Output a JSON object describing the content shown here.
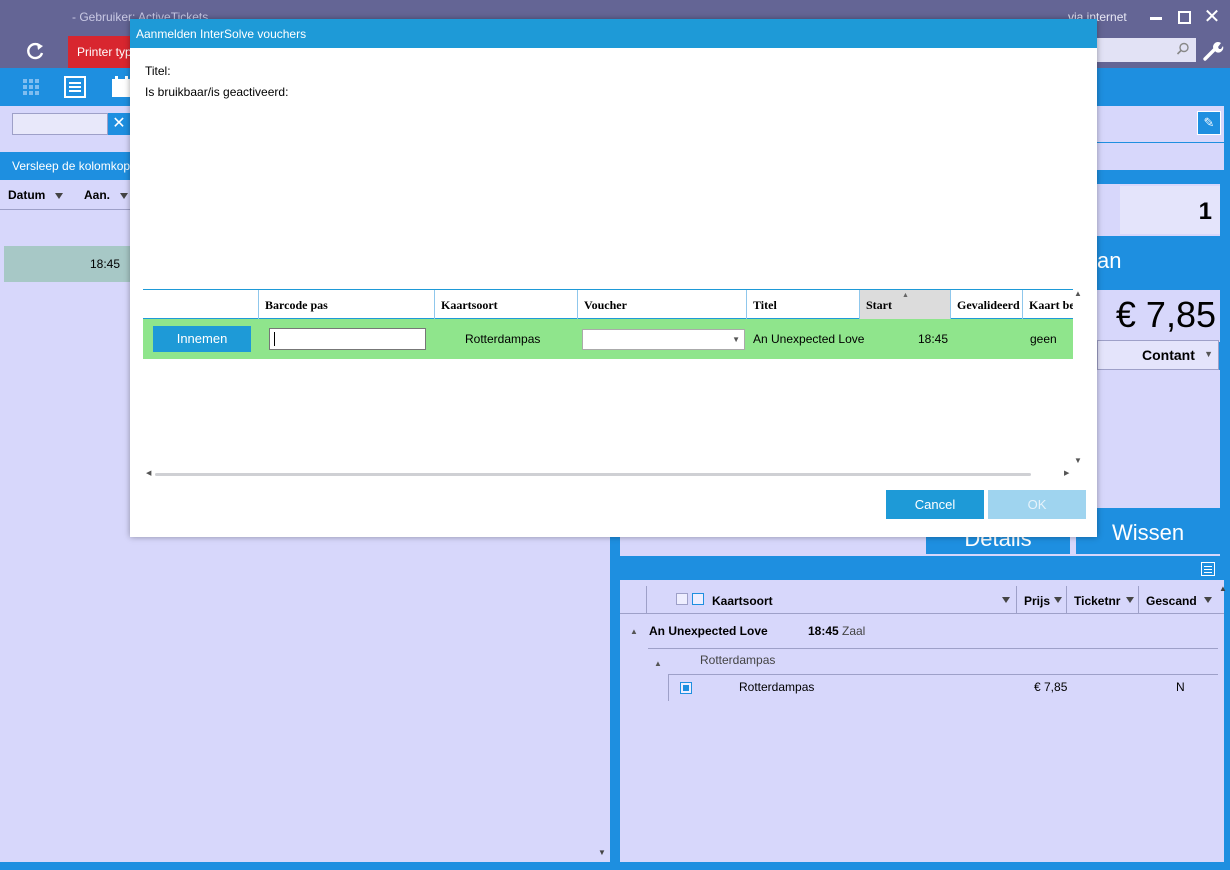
{
  "window": {
    "title": "- Gebruiker: ActiveTickets",
    "connection": "via internet"
  },
  "toolbar": {
    "printer_label": "Printer type"
  },
  "left": {
    "group_hint": "Versleep de kolomkoptekst hierheen om op die kolom te groeperen",
    "columns": [
      "Datum",
      "Aan."
    ],
    "row_time": "18:45"
  },
  "right": {
    "quantity": "1",
    "action_label": "an",
    "total_price": "€ 7,85",
    "payment_method": "Contant",
    "details_label": "Details",
    "wissen_label": "Wissen",
    "tickets": {
      "columns": [
        "Kaartsoort",
        "Prijs",
        "Ticketnr",
        "Gescand"
      ],
      "group": {
        "title": "An Unexpected Love",
        "time": "18:45",
        "hall": "Zaal"
      },
      "subgroup": "Rotterdampas",
      "row": {
        "kaartsoort": "Rotterdampas",
        "prijs": "€ 7,85",
        "gescand": "N"
      }
    }
  },
  "modal": {
    "title": "Aanmelden InterSolve vouchers",
    "label_titel": "Titel:",
    "label_bruikbaar": "Is bruikbaar/is geactiveerd:",
    "columns": {
      "barcode": "Barcode pas",
      "kaartsoort": "Kaartsoort",
      "voucher": "Voucher",
      "titel": "Titel",
      "start": "Start",
      "gevalideerd": "Gevalideerd",
      "kaart_be": "Kaart be"
    },
    "row": {
      "innemen_label": "Innemen",
      "barcode_value": "",
      "kaartsoort": "Rotterdampas",
      "voucher_value": "",
      "titel": "An Unexpected Love",
      "start": "18:45",
      "kaart_be": "geen"
    },
    "cancel_label": "Cancel",
    "ok_label": "OK"
  },
  "colors": {
    "accent_blue": "#1e8fe0",
    "dialog_blue": "#1e9ad7",
    "titlebar": "#646595",
    "panel_bg": "#d7d7fb",
    "printer_red": "#d8262f",
    "row_green": "#8fe58c"
  },
  "icons": [
    "refresh-icon",
    "search-icon",
    "wrench-icon",
    "grid-icon",
    "list-icon",
    "calendar-icon",
    "pencil-icon",
    "export-icon"
  ]
}
